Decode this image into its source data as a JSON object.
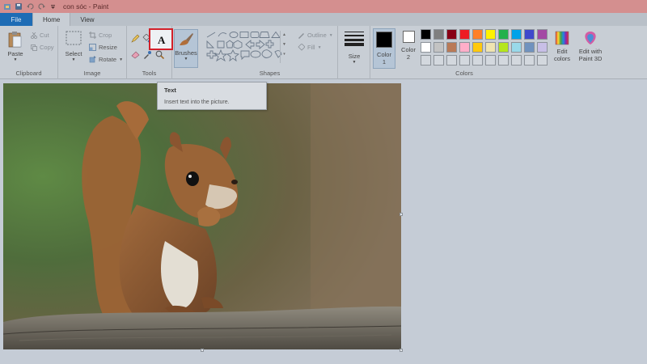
{
  "window": {
    "title": "con sóc - Paint",
    "quick_access_icons": [
      "paint-app-icon",
      "save-icon",
      "undo-icon",
      "redo-icon",
      "customize-arrow-icon"
    ]
  },
  "tabs": {
    "file": "File",
    "home": "Home",
    "view": "View"
  },
  "ribbon": {
    "clipboard": {
      "label": "Clipboard",
      "paste": "Paste",
      "cut": "Cut",
      "copy": "Copy"
    },
    "image": {
      "label": "Image",
      "select": "Select",
      "crop": "Crop",
      "resize": "Resize",
      "rotate": "Rotate"
    },
    "tools": {
      "label": "Tools",
      "text_tool": "A"
    },
    "brushes": {
      "label": "Brushes"
    },
    "shapes": {
      "label": "Shapes",
      "outline": "Outline",
      "fill": "Fill"
    },
    "size": {
      "label": "Size"
    },
    "colors": {
      "label": "Colors",
      "color1": "Color",
      "color1_num": "1",
      "color2": "Color",
      "color2_num": "2",
      "edit_colors": "Edit",
      "edit_colors2": "colors",
      "edit_paint3d": "Edit with",
      "edit_paint3d2": "Paint 3D",
      "color1_value": "#000000",
      "color2_value": "#ffffff",
      "palette_row1": [
        "#000000",
        "#7f7f7f",
        "#880015",
        "#ed1c24",
        "#ff7f27",
        "#fff200",
        "#22b14c",
        "#00a2e8",
        "#3f48cc",
        "#a349a4"
      ],
      "palette_row2": [
        "#ffffff",
        "#c3c3c3",
        "#b97a57",
        "#ffaec9",
        "#ffc90e",
        "#efe4b0",
        "#b5e61d",
        "#99d9ea",
        "#7092be",
        "#c8bfe7"
      ],
      "palette_row3_count": 10
    }
  },
  "tooltip": {
    "title": "Text",
    "description": "Insert text into the picture."
  }
}
